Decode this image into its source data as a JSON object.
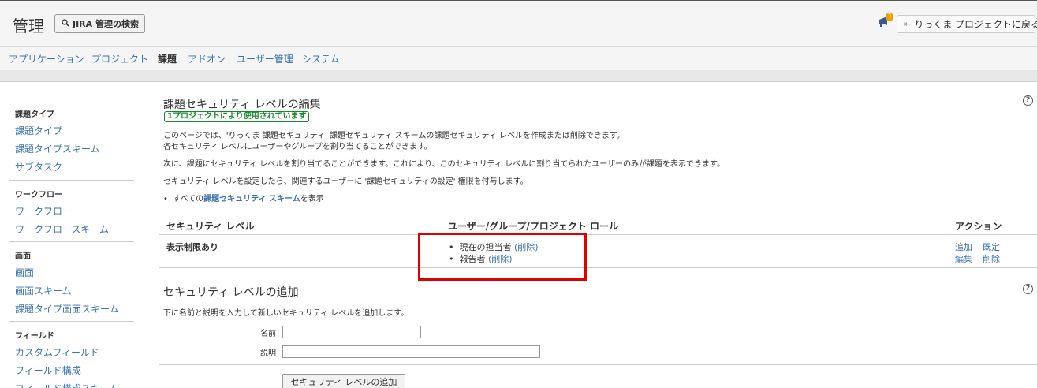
{
  "header": {
    "title": "管理",
    "search_button": "JIRA 管理の検索",
    "back_button": "りっくま プロジェクトに戻る",
    "notification_count": "1"
  },
  "nav": {
    "tabs": [
      {
        "label": "アプリケーション"
      },
      {
        "label": "プロジェクト"
      },
      {
        "label": "課題"
      },
      {
        "label": "アドオン"
      },
      {
        "label": "ユーザー管理"
      },
      {
        "label": "システム"
      }
    ]
  },
  "sidebar": {
    "sections": [
      {
        "heading": "課題タイプ",
        "items": [
          "課題タイプ",
          "課題タイプスキーム",
          "サブタスク"
        ]
      },
      {
        "heading": "ワークフロー",
        "items": [
          "ワークフロー",
          "ワークフロースキーム"
        ]
      },
      {
        "heading": "画面",
        "items": [
          "画面",
          "画面スキーム",
          "課題タイプ画面スキーム"
        ]
      },
      {
        "heading": "フィールド",
        "items": [
          "カスタムフィールド",
          "フィールド構成",
          "フィールド構成スキーム"
        ]
      }
    ]
  },
  "main": {
    "title": "課題セキュリティ レベルの編集",
    "usage_lozenge": "1プロジェクトにより使用されています",
    "desc1": "このページでは、'りっくま 課題セキュリティ' 課題セキュリティ スキームの課題セキュリティ レベルを作成または削除できます。",
    "desc2": "各セキュリティ レベルにユーザーやグループを割り当てることができます。",
    "desc3": "次に、課題にセキュリティ レベルを割り当てることができます。これにより、このセキュリティ レベルに割り当てられたユーザーのみが課題を表示できます。",
    "desc4": "セキュリティ レベルを設定したら、関連するユーザーに '課題セキュリティの設定' 権限を付与します。",
    "all_schemes_prefix": "すべての",
    "all_schemes_link": "課題セキュリティ スキーム",
    "all_schemes_suffix": "を表示",
    "table": {
      "headers": [
        "セキュリティ レベル",
        "ユーザー/グループ/プロジェクト ロール",
        "アクション"
      ],
      "rows": [
        {
          "level": "表示制限あり",
          "members": [
            {
              "name": "現在の担当者",
              "action": "(削除)"
            },
            {
              "name": "報告者",
              "action": "(削除)"
            }
          ],
          "actions": [
            "追加",
            "既定",
            "編集",
            "削除"
          ]
        }
      ]
    },
    "add_section": {
      "title": "セキュリティ レベルの追加",
      "desc": "下に名前と説明を入力して新しいセキュリティ レベルを追加します。",
      "name_label": "名前",
      "name_value": "",
      "desc_label": "説明",
      "desc_value": "",
      "submit": "セキュリティ レベルの追加"
    }
  }
}
